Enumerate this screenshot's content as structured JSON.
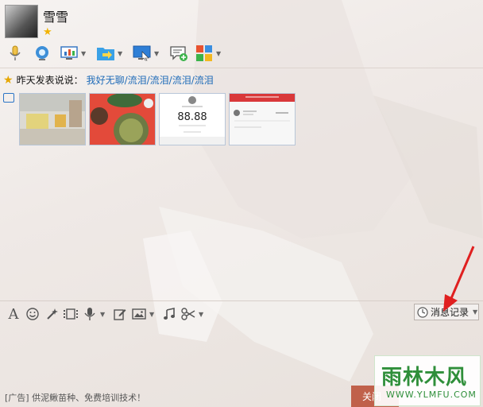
{
  "contact": {
    "name": "雪雪",
    "level_icon": "star-icon"
  },
  "toolbar_icons": [
    "microphone-icon",
    "video-camera-icon",
    "screen-share-icon",
    "send-file-icon",
    "remote-desktop-icon",
    "new-message-icon",
    "apps-icon"
  ],
  "status": {
    "label": "昨天发表说说：",
    "text": "我好无聊/流泪/流泪/流泪/流泪"
  },
  "photos": [
    {
      "name": "photo-1"
    },
    {
      "name": "photo-2"
    },
    {
      "name": "photo-3",
      "amount": "88.88"
    },
    {
      "name": "photo-4"
    }
  ],
  "input_tools": [
    "font-icon",
    "emoji-icon",
    "magic-icon",
    "video-clip-icon",
    "voice-icon",
    "edit-icon",
    "image-icon",
    "music-icon",
    "scissors-icon"
  ],
  "history_button": {
    "label": "消息记录"
  },
  "ad_text": "[广告] 供泥鳅苗种、免费培训技术！",
  "close_button": {
    "label": "关闭"
  },
  "watermark": {
    "main": "雨林木风",
    "sub": "WWW.YLMFU.COM"
  }
}
